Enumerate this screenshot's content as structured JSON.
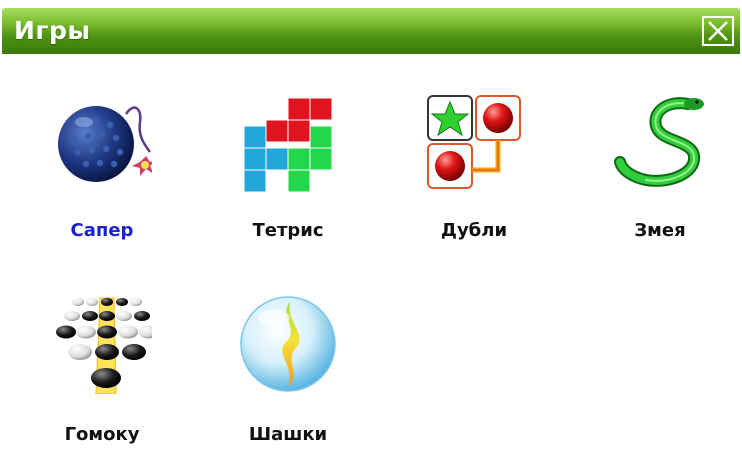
{
  "window": {
    "title": "Игры",
    "close_icon": "close-icon"
  },
  "games": [
    {
      "label": "Сапер",
      "icon": "bomb-icon",
      "active": true
    },
    {
      "label": "Тетрис",
      "icon": "tetris-blocks-icon",
      "active": false
    },
    {
      "label": "Дубли",
      "icon": "matching-pairs-icon",
      "active": false
    },
    {
      "label": "Змея",
      "icon": "snake-icon",
      "active": false
    },
    {
      "label": "Гомоку",
      "icon": "gomoku-stones-icon",
      "active": false
    },
    {
      "label": "Шашки",
      "icon": "glass-sphere-icon",
      "active": false
    }
  ],
  "colors": {
    "title_bar": "#4f9213",
    "active_label": "#1a24c8",
    "label": "#111111"
  }
}
